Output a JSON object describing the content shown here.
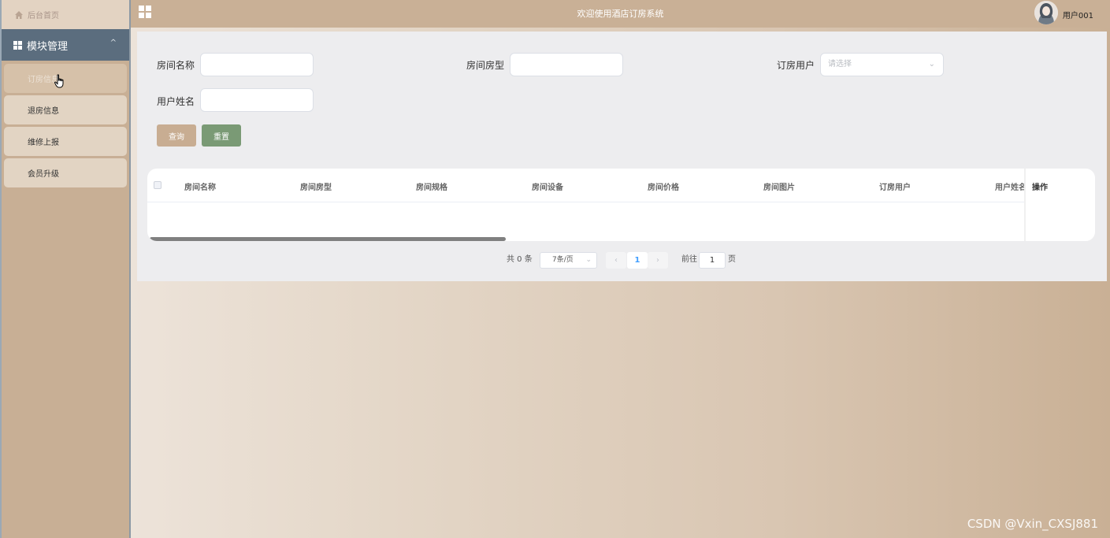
{
  "sidebar": {
    "home_label": "后台首页",
    "module_label": "模块管理",
    "items": [
      {
        "label": "订房信息"
      },
      {
        "label": "退房信息"
      },
      {
        "label": "维修上报"
      },
      {
        "label": "会员升级"
      }
    ]
  },
  "header": {
    "title": "欢迎使用酒店订房系统",
    "user": "用户001"
  },
  "search": {
    "room_name_label": "房间名称",
    "room_type_label": "房间房型",
    "booking_user_label": "订房用户",
    "booking_user_placeholder": "请选择",
    "user_name_label": "用户姓名",
    "search_button": "查询",
    "reset_button": "重置"
  },
  "table": {
    "columns": [
      "房间名称",
      "房间房型",
      "房间规格",
      "房间设备",
      "房间价格",
      "房间图片",
      "订房用户",
      "用户姓名"
    ],
    "action_column": "操作"
  },
  "pagination": {
    "total": "共 0 条",
    "page_size": "7条/页",
    "current_page": "1",
    "goto_label": "前往",
    "goto_value": "1",
    "page_suffix": "页"
  },
  "watermark": "CSDN @Vxin_CXSJ881"
}
